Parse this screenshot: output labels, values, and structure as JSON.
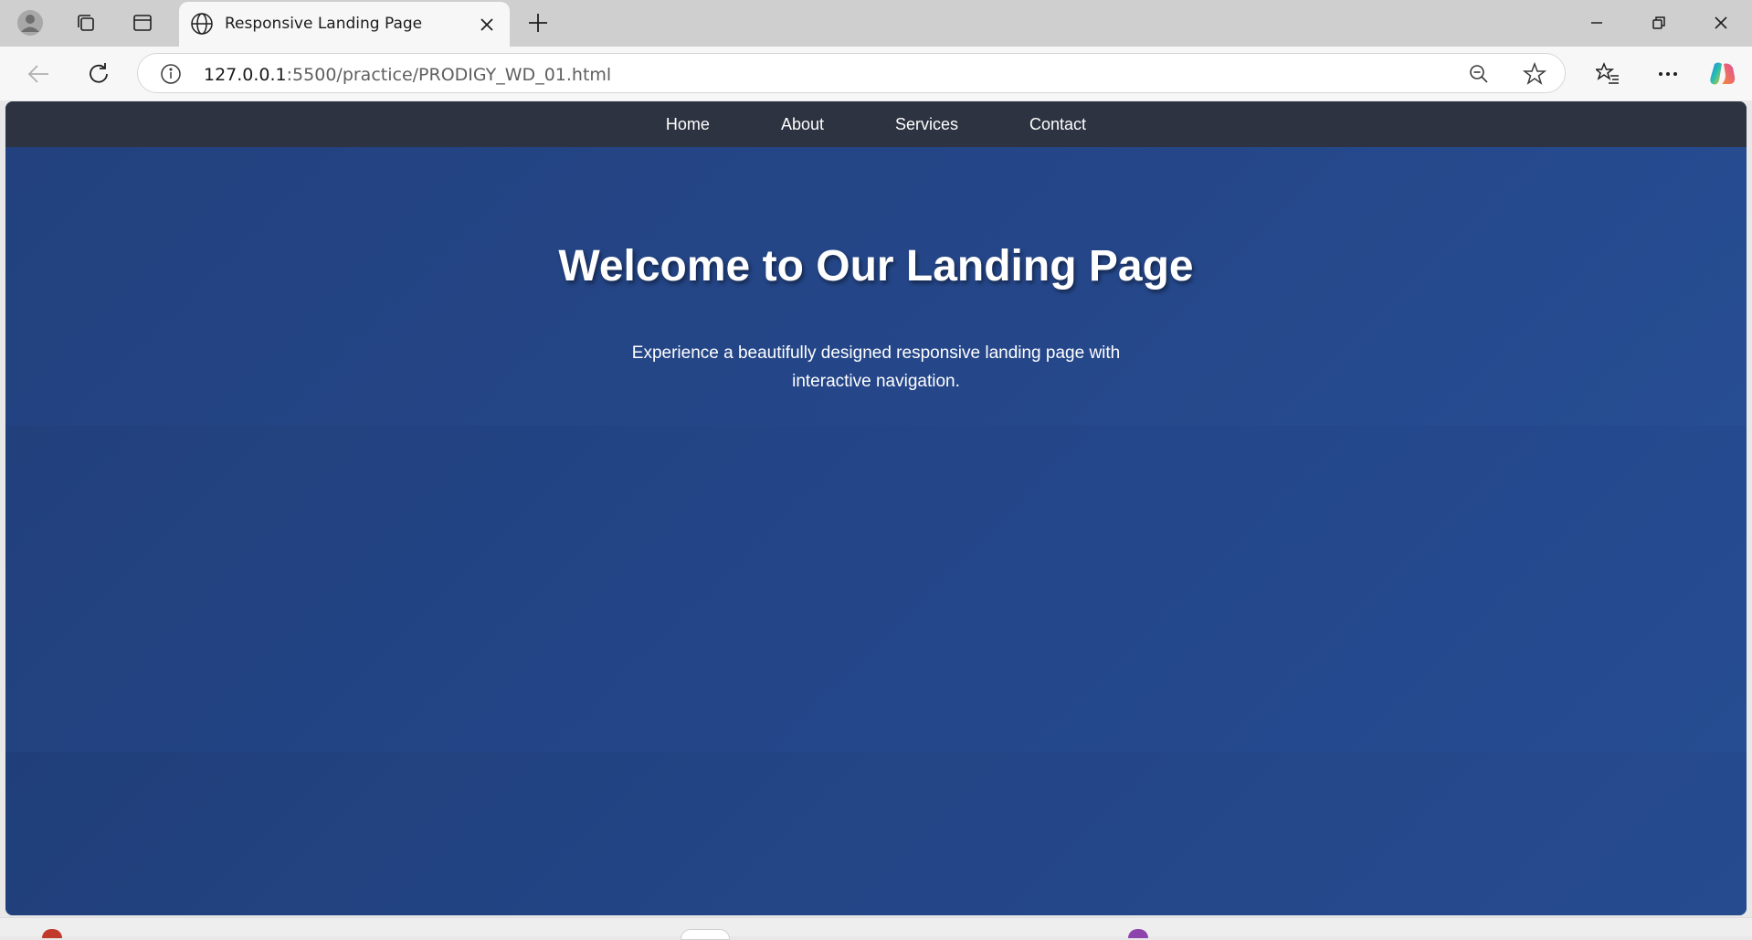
{
  "browser": {
    "tab": {
      "title": "Responsive Landing Page"
    },
    "address": {
      "host": "127.0.0.1",
      "path": ":5500/practice/PRODIGY_WD_01.html"
    }
  },
  "site": {
    "nav": [
      "Home",
      "About",
      "Services",
      "Contact"
    ],
    "hero": {
      "title": "Welcome to Our Landing Page",
      "subtitle": "Experience a beautifully designed responsive landing page with interactive navigation."
    }
  },
  "colors": {
    "nav_bg": "#2d3340",
    "hero_bg": "#24437f",
    "tab_strip": "#cfcfcf"
  },
  "icons": {
    "tabstrip": [
      "profile-icon",
      "collections-icon",
      "vertical-tabs-icon"
    ],
    "toolbar": [
      "back-icon",
      "refresh-icon",
      "site-info-icon",
      "zoom-out-icon",
      "favorite-star-icon",
      "favorites-list-icon",
      "more-menu-icon",
      "copilot-icon"
    ]
  }
}
